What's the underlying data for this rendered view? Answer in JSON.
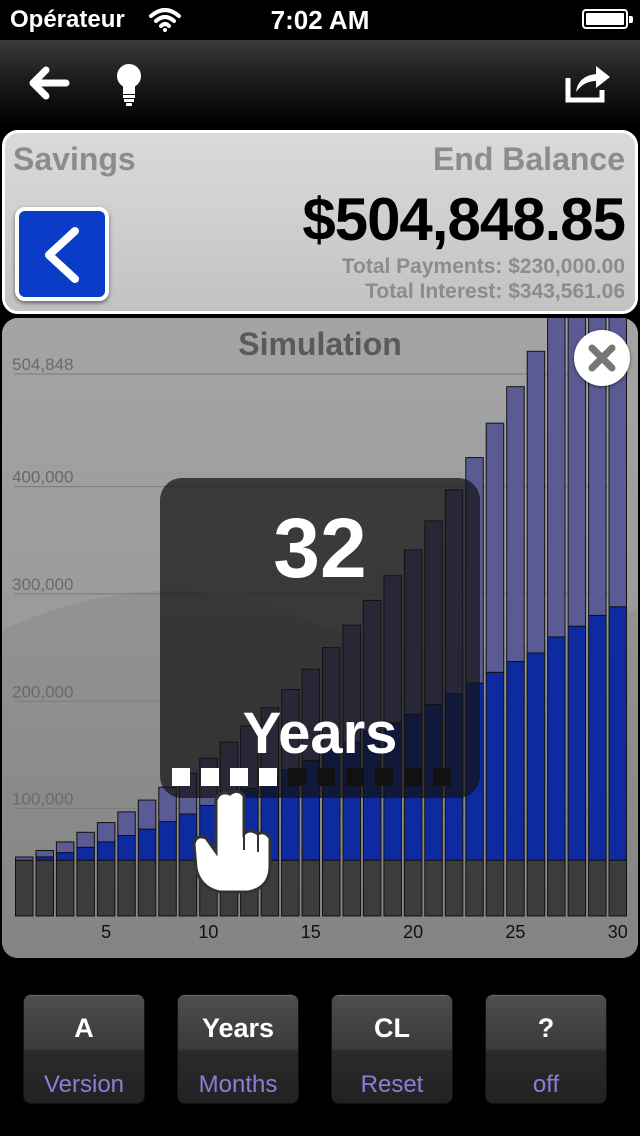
{
  "status_bar": {
    "carrier": "Opérateur",
    "time": "7:02 AM",
    "wifi_icon": "wifi-icon",
    "battery_icon": "battery-icon"
  },
  "nav": {
    "back_icon": "back-arrow-icon",
    "tip_icon": "lightbulb-icon",
    "share_icon": "share-icon"
  },
  "savings": {
    "title": "Savings",
    "end_balance_label": "End Balance",
    "end_balance": "$504,848.85",
    "total_payments": "Total Payments: $230,000.00",
    "total_interest": "Total Interest: $343,561.06",
    "back_icon": "chevron-left-icon"
  },
  "simulation": {
    "title": "Simulation",
    "close_icon": "close-icon",
    "overlay": {
      "value": "32",
      "unit": "Years",
      "hand_icon": "pointing-hand-icon",
      "dots_filled": 4,
      "dots_total": 10
    }
  },
  "chart_data": {
    "type": "bar",
    "stacked": true,
    "x": [
      1,
      2,
      3,
      4,
      5,
      6,
      7,
      8,
      9,
      10,
      11,
      12,
      13,
      14,
      15,
      16,
      17,
      18,
      19,
      20,
      21,
      22,
      23,
      24,
      25,
      26,
      27,
      28,
      29,
      30
    ],
    "x_tick_labels": [
      "5",
      "10",
      "15",
      "20",
      "25",
      "30"
    ],
    "y_tick_labels": [
      "504,848",
      "400,000",
      "300,000",
      "200,000",
      "100,000"
    ],
    "ylim": [
      0,
      504848
    ],
    "grid": true,
    "colors": {
      "base": "#3c3c3c",
      "middle": "#0d2aa0",
      "top": "#5a5a94"
    },
    "series": [
      {
        "values": [
          52000,
          52000,
          52000,
          52000,
          52000,
          52000,
          52000,
          52000,
          52000,
          52000,
          52000,
          52000,
          52000,
          52000,
          52000,
          52000,
          52000,
          52000,
          52000,
          52000,
          52000,
          52000,
          52000,
          52000,
          52000,
          52000,
          52000,
          52000,
          52000,
          52000
        ]
      },
      {
        "values": [
          0,
          3000,
          7000,
          12000,
          17000,
          23000,
          29000,
          36000,
          43000,
          51000,
          59000,
          67000,
          76000,
          84000,
          93000,
          102000,
          110000,
          120000,
          128000,
          136000,
          145000,
          155000,
          165000,
          175000,
          185000,
          193000,
          208000,
          218000,
          228000,
          236000
        ]
      },
      {
        "values": [
          3000,
          6000,
          10000,
          14000,
          18000,
          22000,
          27000,
          32000,
          38000,
          44000,
          51000,
          58000,
          66000,
          75000,
          85000,
          96000,
          109000,
          122000,
          137000,
          153000,
          171000,
          190000,
          210000,
          232000,
          256000,
          281000,
          307000,
          335000,
          364000,
          395000
        ]
      }
    ]
  },
  "buttons": [
    {
      "top": "A",
      "bottom": "Version"
    },
    {
      "top": "Years",
      "bottom": "Months"
    },
    {
      "top": "CL",
      "bottom": "Reset"
    },
    {
      "top": "?",
      "bottom": "off"
    }
  ]
}
